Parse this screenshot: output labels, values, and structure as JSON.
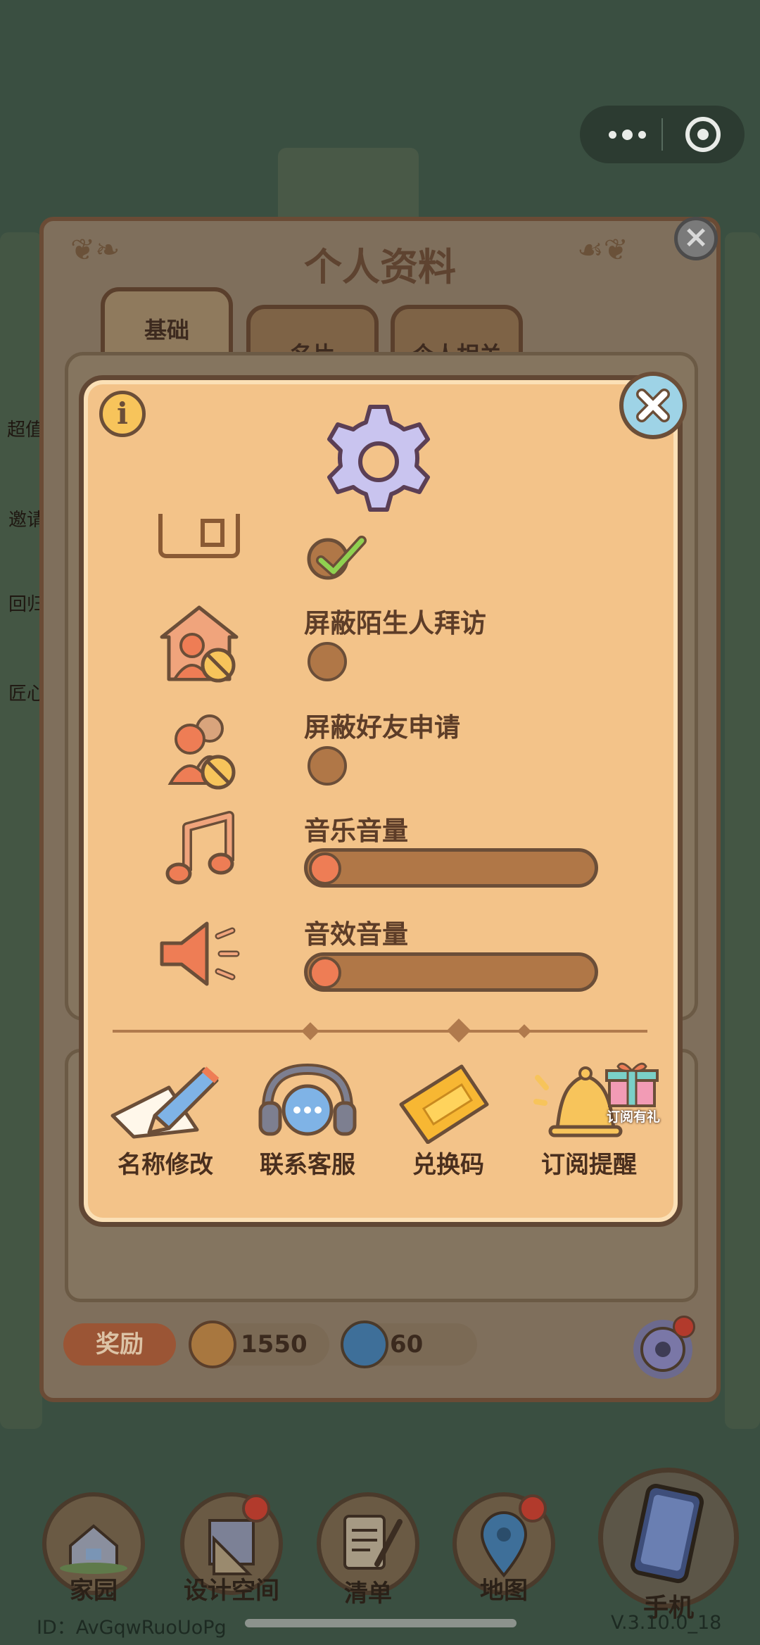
{
  "capsule": {
    "more_icon": "more-dots-icon",
    "close_icon": "target-circle-icon"
  },
  "profile": {
    "title": "个人资料",
    "tabs": [
      {
        "label": "基础"
      },
      {
        "label": "名片"
      },
      {
        "label": "个人相关"
      }
    ],
    "left_side_labels": [
      "超值",
      "邀请",
      "回归",
      "匠心"
    ],
    "rewards": {
      "badge": "奖励",
      "coins": "1550",
      "gems": "60"
    }
  },
  "settings": {
    "info_icon": "i",
    "items": [
      {
        "label": "",
        "type": "checkbox",
        "checked": true
      },
      {
        "label": "屏蔽陌生人拜访",
        "type": "toggle",
        "on": false
      },
      {
        "label": "屏蔽好友申请",
        "type": "toggle",
        "on": false
      },
      {
        "label": "音乐音量",
        "type": "slider",
        "value": 0
      },
      {
        "label": "音效音量",
        "type": "slider",
        "value": 0
      }
    ],
    "actions": [
      {
        "label": "名称修改",
        "icon": "pencil-paper-icon"
      },
      {
        "label": "联系客服",
        "icon": "headset-chat-icon"
      },
      {
        "label": "兑换码",
        "icon": "ticket-icon"
      },
      {
        "label": "订阅提醒",
        "icon": "bell-icon"
      }
    ],
    "gift_label": "订阅有礼"
  },
  "nav": {
    "items": [
      {
        "label": "家园",
        "badge": false
      },
      {
        "label": "设计空间",
        "badge": true
      },
      {
        "label": "清单",
        "badge": false
      },
      {
        "label": "地图",
        "badge": true
      },
      {
        "label": "手机",
        "badge": false
      }
    ]
  },
  "footer": {
    "id": "ID：AvGqwRuoUoPg",
    "version": "V.3.10.0_18"
  },
  "colors": {
    "modal_bg": "#f3c389",
    "outline": "#614734",
    "accent_orange": "#ee7d55",
    "slider_track": "#b07747"
  }
}
